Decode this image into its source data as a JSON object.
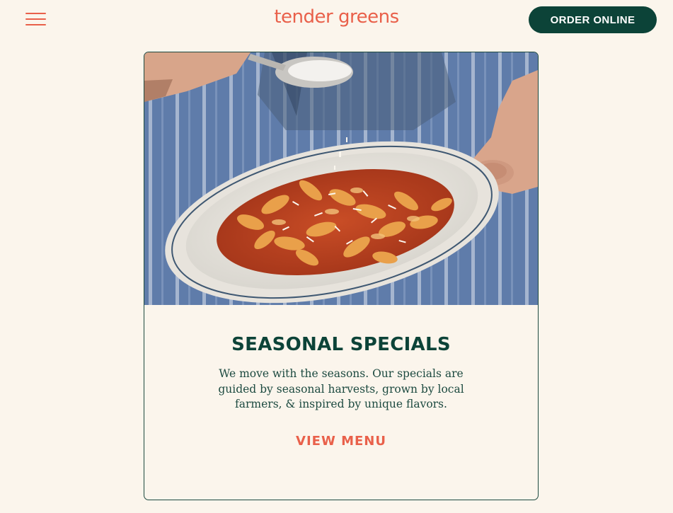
{
  "header": {
    "logo_text": "tender greens",
    "order_button_label": "ORDER ONLINE",
    "menu_icon": "hamburger-menu-icon"
  },
  "card": {
    "image_alt": "Bowl of rotini pasta with tomato meat sauce and grated cheese held over a striped apron",
    "title": "SEASONAL SPECIALS",
    "description": "We move with the seasons. Our specials are guided by seasonal harvests, grown by local farmers, & inspired by unique flavors.",
    "link_label": "VIEW MENU"
  },
  "colors": {
    "background": "#fbf5ec",
    "brand_coral": "#e9604a",
    "brand_green": "#0c4338"
  }
}
